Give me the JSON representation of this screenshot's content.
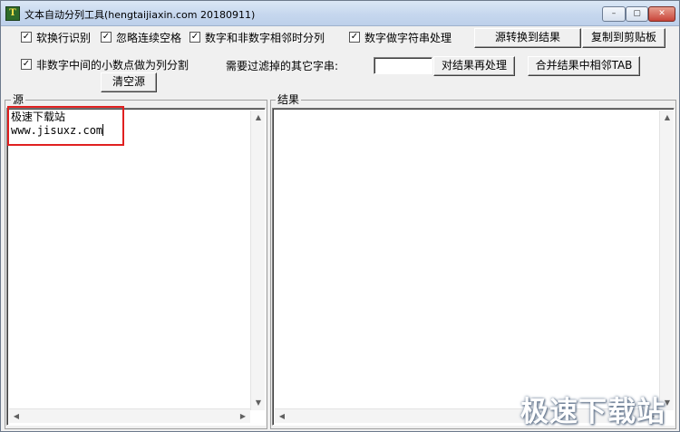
{
  "window": {
    "title": "文本自动分列工具(hengtaijiaxin.com 20180911)",
    "icon": "app-icon",
    "controls": {
      "minimize": "–",
      "maximize": "▢",
      "close": "✕"
    }
  },
  "options": {
    "soft_newline": {
      "label": "软换行识别",
      "checked": true
    },
    "ignore_spaces": {
      "label": "忽略连续空格",
      "checked": true
    },
    "split_digit_nondigit": {
      "label": "数字和非数字相邻时分列",
      "checked": true
    },
    "digits_as_string": {
      "label": "数字做字符串处理",
      "checked": true
    },
    "decimal_split": {
      "label": "非数字中间的小数点做为列分割",
      "checked": true
    }
  },
  "filter": {
    "label": "需要过滤掉的其它字串:",
    "value": ""
  },
  "buttons": {
    "convert": "源转换到结果",
    "copy": "复制到剪贴板",
    "reprocess": "对结果再处理",
    "merge_tab": "合并结果中相邻TAB",
    "clear_source": "清空源"
  },
  "source": {
    "caption": "源",
    "lines": [
      "极速下载站",
      "www.jisuxz.com"
    ]
  },
  "result": {
    "caption": "结果",
    "text": ""
  },
  "watermark": "极速下载站",
  "colors": {
    "highlight": "#e02020"
  }
}
